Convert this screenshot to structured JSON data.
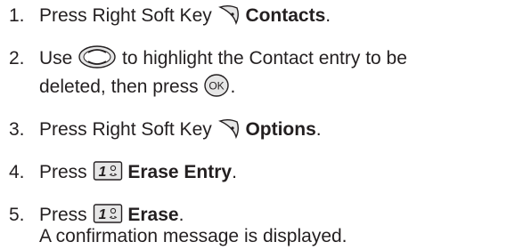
{
  "steps": [
    {
      "number": "1.",
      "parts": {
        "before": "Press Right Soft Key",
        "bold": "Contacts",
        "after": "."
      },
      "icon": "right-soft-key-icon"
    },
    {
      "number": "2.",
      "parts": {
        "use": "Use",
        "mid": "to highlight the Contact entry to be",
        "line2": "deleted, then press",
        "end": "."
      },
      "icons": [
        "nav-up-down-key-icon",
        "ok-key-icon"
      ],
      "ok_label": "OK"
    },
    {
      "number": "3.",
      "parts": {
        "before": "Press Right Soft Key",
        "bold": "Options",
        "after": "."
      },
      "icon": "right-soft-key-icon"
    },
    {
      "number": "4.",
      "parts": {
        "before": "Press",
        "bold": "Erase Entry",
        "after": "."
      },
      "icon": "one-key-icon",
      "key_label": "1"
    },
    {
      "number": "5.",
      "parts": {
        "before": "Press",
        "bold": "Erase",
        "after": ".",
        "line2": "A confirmation message is displayed."
      },
      "icon": "one-key-icon",
      "key_label": "1"
    }
  ],
  "colors": {
    "text": "#231f20",
    "icon_fill": "#e6e6e6",
    "icon_stroke": "#231f20"
  }
}
